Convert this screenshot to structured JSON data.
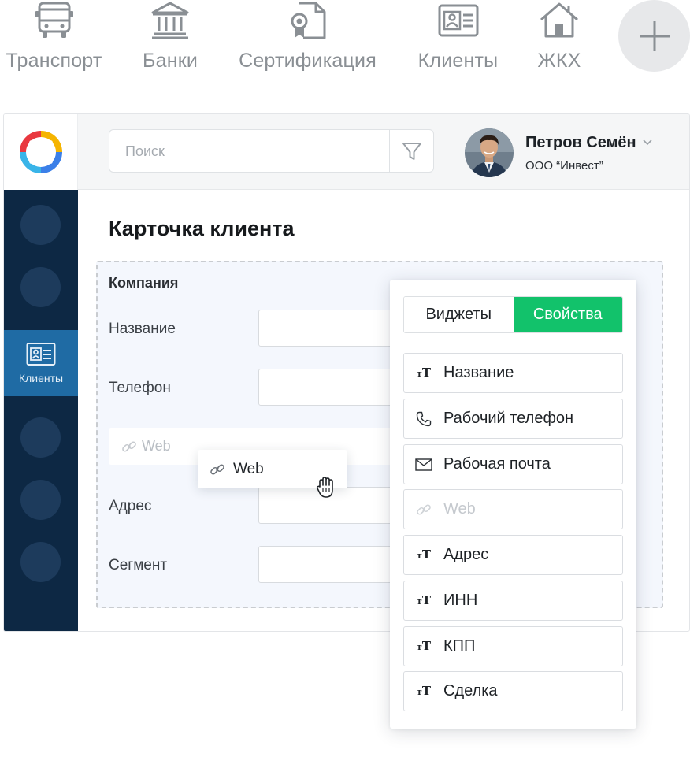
{
  "categories": [
    {
      "label": "Транспорт",
      "icon": "bus-icon"
    },
    {
      "label": "Банки",
      "icon": "bank-icon"
    },
    {
      "label": "Сертификация",
      "icon": "certificate-document-icon"
    },
    {
      "label": "Клиенты",
      "icon": "id-card-icon"
    },
    {
      "label": "ЖКХ",
      "icon": "house-icon"
    }
  ],
  "add_button_icon": "plus-icon",
  "header": {
    "search_placeholder": "Поиск",
    "filter_icon": "filter-icon",
    "user": {
      "name": "Петров Семён",
      "org": "ООО “Инвест”"
    }
  },
  "sidebar": {
    "active_label": "Клиенты",
    "active_icon": "id-card-icon"
  },
  "page": {
    "title": "Карточка клиента",
    "section": "Компания",
    "fields": [
      "Название",
      "Телефон",
      "Адрес",
      "Сегмент"
    ],
    "ghost_field": "Web"
  },
  "drag_item": {
    "label": "Web",
    "icon": "link-icon"
  },
  "panel": {
    "tabs": [
      {
        "label": "Виджеты",
        "active": false
      },
      {
        "label": "Свойства",
        "active": true
      }
    ],
    "properties": [
      {
        "label": "Название",
        "icon": "text-type-icon",
        "disabled": false
      },
      {
        "label": "Рабочий телефон",
        "icon": "phone-icon",
        "disabled": false
      },
      {
        "label": "Рабочая почта",
        "icon": "envelope-icon",
        "disabled": false
      },
      {
        "label": "Web",
        "icon": "link-icon",
        "disabled": true
      },
      {
        "label": "Адрес",
        "icon": "text-type-icon",
        "disabled": false
      },
      {
        "label": "ИНН",
        "icon": "text-type-icon",
        "disabled": false
      },
      {
        "label": "КПП",
        "icon": "text-type-icon",
        "disabled": false
      },
      {
        "label": "Сделка",
        "icon": "text-type-icon",
        "disabled": false
      }
    ]
  },
  "colors": {
    "accent_green": "#12c26b",
    "sidebar_bg": "#0d2844",
    "sidebar_active": "#1f6ba4"
  }
}
